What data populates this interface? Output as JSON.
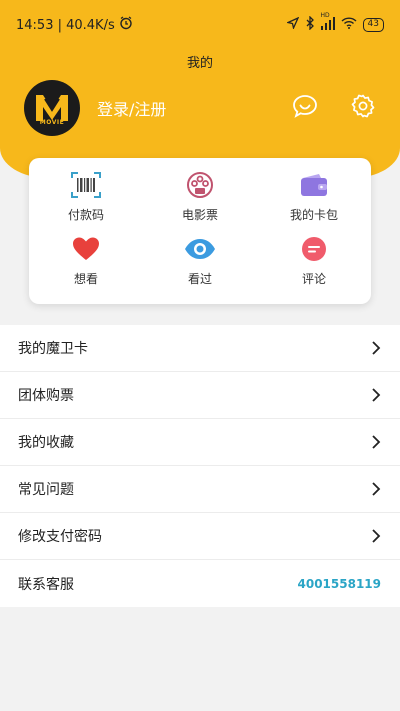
{
  "status_bar": {
    "time_speed": "14:53 | 40.4K/s",
    "network_badge": "HD",
    "battery": "43"
  },
  "page": {
    "title": "我的"
  },
  "profile": {
    "avatar_text": "MOVIE",
    "login_label": "登录/注册"
  },
  "quick_actions": [
    {
      "label": "付款码",
      "icon": "barcode-scan-icon"
    },
    {
      "label": "电影票",
      "icon": "film-ticket-icon"
    },
    {
      "label": "我的卡包",
      "icon": "wallet-icon"
    },
    {
      "label": "想看",
      "icon": "heart-icon"
    },
    {
      "label": "看过",
      "icon": "eye-icon"
    },
    {
      "label": "评论",
      "icon": "comment-icon"
    }
  ],
  "menu": [
    {
      "label": "我的魔卫卡"
    },
    {
      "label": "团体购票"
    },
    {
      "label": "我的收藏"
    },
    {
      "label": "常见问题"
    },
    {
      "label": "修改支付密码"
    },
    {
      "label": "联系客服",
      "value": "4001558119"
    }
  ],
  "colors": {
    "brand": "#f7b81b",
    "accent_phone": "#2ba5c6",
    "heart": "#e8413c",
    "eye": "#3b9be0",
    "comment": "#f05b6b",
    "wallet": "#8e76e0",
    "film": "#c0536e"
  }
}
